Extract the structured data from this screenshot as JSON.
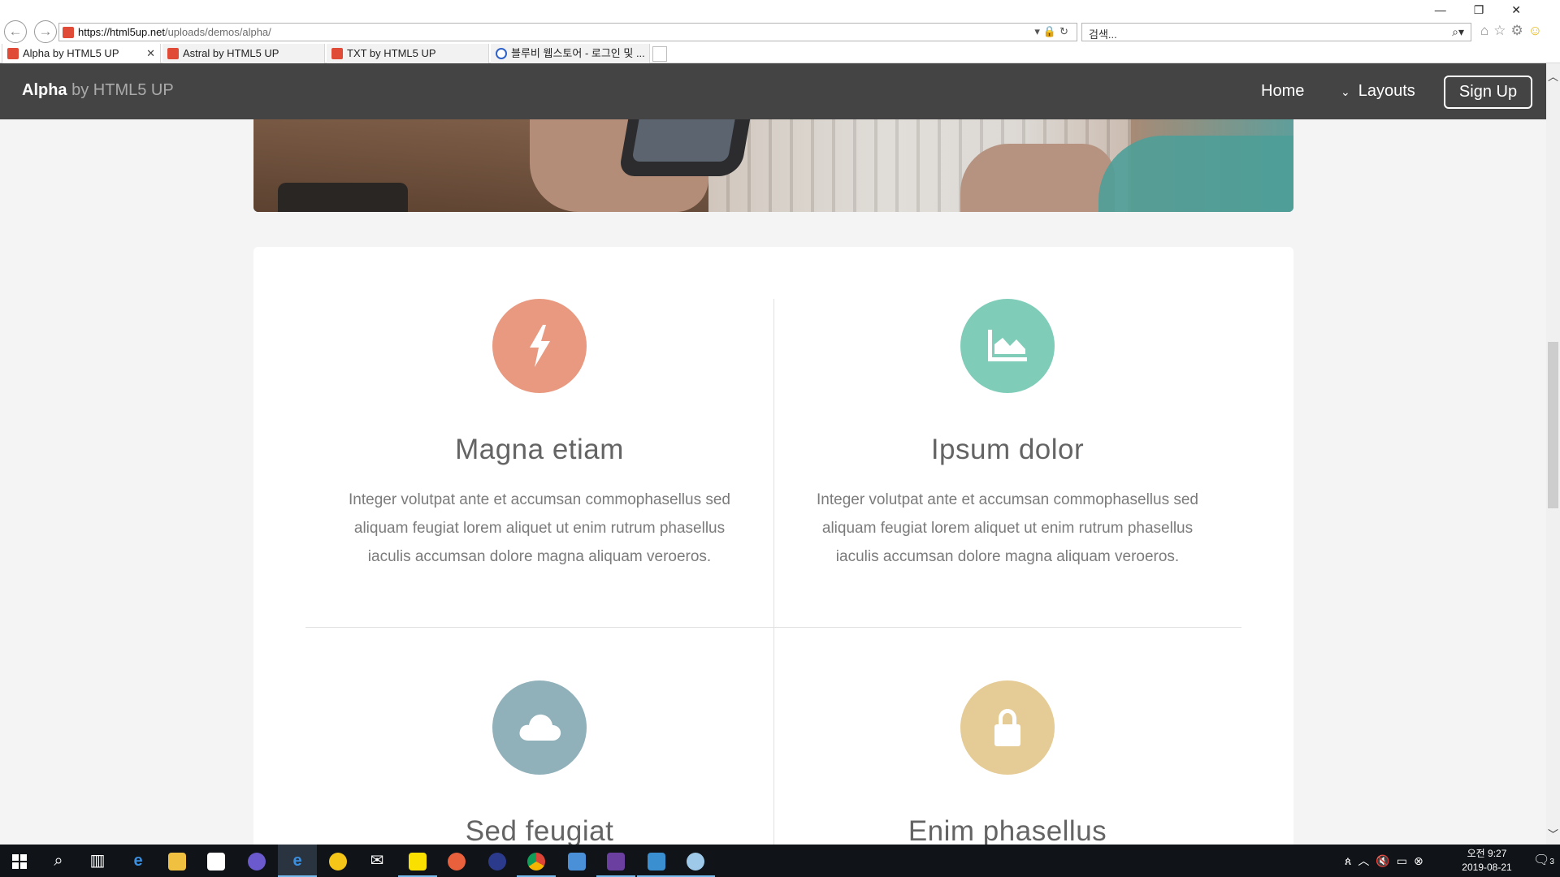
{
  "browser": {
    "url_host": "https://html5up.net",
    "url_path": "/uploads/demos/alpha/",
    "search_placeholder": "검색...",
    "tabs": [
      {
        "label": "Alpha by HTML5 UP",
        "close": "✕"
      },
      {
        "label": "Astral by HTML5 UP"
      },
      {
        "label": "TXT by HTML5 UP"
      },
      {
        "label": "블루비 웹스토어 - 로그인 및 ..."
      }
    ],
    "window_controls": [
      "—",
      "❐",
      "✕"
    ],
    "icons": [
      "back-arrow-icon",
      "forward-arrow-icon",
      "lock-icon",
      "refresh-icon",
      "home-icon",
      "favorites-star-icon",
      "settings-gear-icon",
      "smiley-feedback-icon"
    ]
  },
  "site": {
    "logo_bold": "Alpha",
    "logo_sub": "by HTML5 UP",
    "nav": {
      "home": "Home",
      "layouts": "Layouts",
      "signup": "Sign Up"
    }
  },
  "features": [
    {
      "title": "Magna etiam",
      "icon": "bolt-icon",
      "color": "#e89980",
      "text": "Integer volutpat ante et accumsan commophasellus sed aliquam feugiat lorem aliquet ut enim rutrum phasellus iaculis accumsan dolore magna aliquam veroeros."
    },
    {
      "title": "Ipsum dolor",
      "icon": "area-chart-icon",
      "color": "#7fcdb8",
      "text": "Integer volutpat ante et accumsan commophasellus sed aliquam feugiat lorem aliquet ut enim rutrum phasellus iaculis accumsan dolore magna aliquam veroeros."
    },
    {
      "title": "Sed feugiat",
      "icon": "cloud-icon",
      "color": "#90b0ba"
    },
    {
      "title": "Enim phasellus",
      "icon": "lock-icon",
      "color": "#e5cb95"
    }
  ],
  "taskbar": {
    "clock_time": "오전 9:27",
    "clock_date": "2019-08-21",
    "notification_count": "3",
    "apps": [
      "windows-start-icon",
      "search-icon",
      "task-view-icon",
      "edge-icon",
      "file-explorer-icon",
      "store-icon",
      "browser-globe-icon",
      "internet-explorer-icon",
      "app-icon",
      "mail-icon",
      "kakaotalk-icon",
      "app-icon",
      "app-icon",
      "chrome-icon",
      "app-icon",
      "app-icon",
      "app-icon",
      "app-icon"
    ]
  }
}
